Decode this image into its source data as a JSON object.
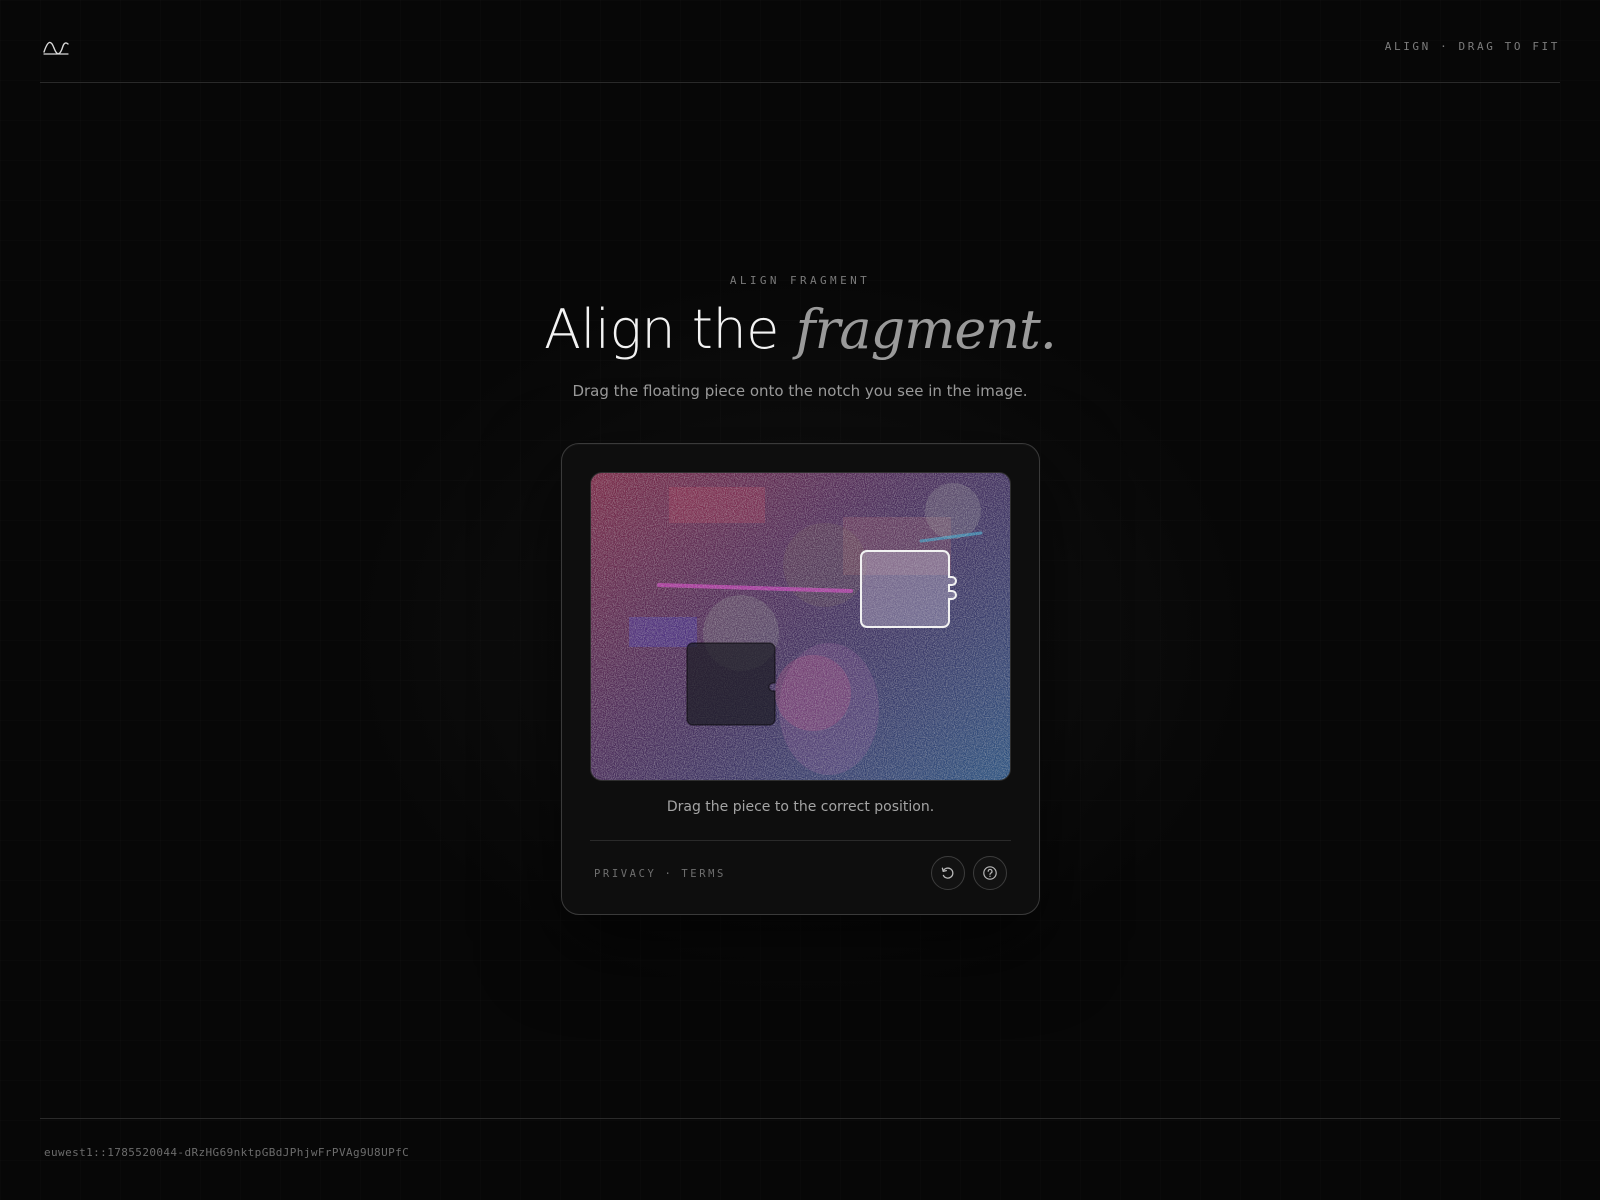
{
  "header": {
    "logo": "wave-logo-icon",
    "meta": "ALIGN · DRAG TO FIT"
  },
  "hero": {
    "eyebrow": "ALIGN FRAGMENT",
    "title_plain": "Align the ",
    "title_accent": "fragment.",
    "subtitle": "Drag the floating piece onto the notch you see in the image."
  },
  "puzzle": {
    "status": "Drag the piece to the correct position.",
    "links": {
      "privacy": "PRIVACY",
      "separator": "·",
      "terms": "TERMS"
    },
    "icons": {
      "refresh": "refresh-icon",
      "help": "help-icon"
    }
  },
  "footer": {
    "session_id": "euwest1::1785520044-dRzHG69nktpGBdJPhjwFrPVAg9U8UPfC"
  }
}
